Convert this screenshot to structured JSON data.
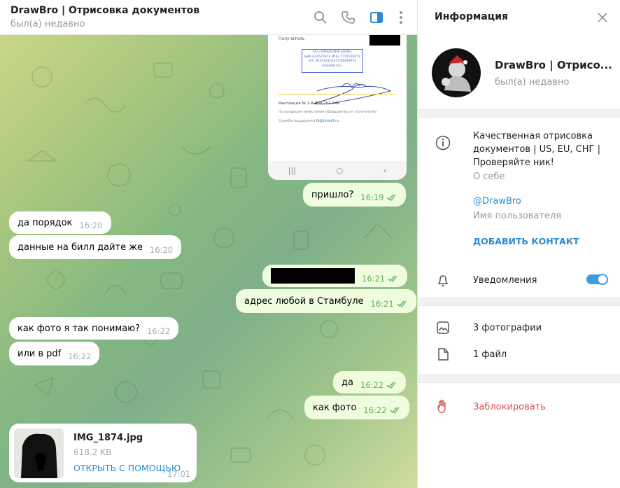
{
  "header": {
    "title": "DrawBro | Отрисовка документов",
    "status": "был(а) недавно"
  },
  "receipt": {
    "recipient_label": "Получатель",
    "stamp_line1": "АО «ТИНЬКОФФ БАНК»",
    "stamp_line2": "БИК 044525974 ИНН 7710140679",
    "stamp_line3": "К/С 30101810145250000974",
    "stamp_line4": "БАБАЕВ А.Е.",
    "receipt_no": "Квитанция  № 1-8-800-251-949",
    "help_line": "По вопросам зачисления обращайтесь к получателю",
    "support_label": "Служба поддержки",
    "support_email": "fb@tinkoff.ru"
  },
  "messages": [
    {
      "text": "пришло?",
      "time": "16:19",
      "dir": "out"
    },
    {
      "text": "да порядок",
      "time": "16:20",
      "dir": "in"
    },
    {
      "text": "данные на билл дайте же",
      "time": "16:20",
      "dir": "in"
    },
    {
      "text": "",
      "time": "16:21",
      "dir": "out"
    },
    {
      "text": "адрес любой в Стамбуле",
      "time": "16:21",
      "dir": "out"
    },
    {
      "text": "как фото я так понимаю?",
      "time": "16:22",
      "dir": "in"
    },
    {
      "text": "или в pdf",
      "time": "16:22",
      "dir": "in"
    },
    {
      "text": "да",
      "time": "16:22",
      "dir": "out"
    },
    {
      "text": "как фото",
      "time": "16:22",
      "dir": "out"
    }
  ],
  "file": {
    "name": "IMG_1874.jpg",
    "size": "618.2 KB",
    "action": "ОТКРЫТЬ С ПОМОЩЬЮ",
    "time": "17:01"
  },
  "info": {
    "title": "Информация",
    "name": "DrawBro | Отрисо...",
    "status": "был(а) недавно",
    "about": [
      "Качественная отрисовка",
      "документов | US, EU, СНГ |",
      "Проверяйте ник!"
    ],
    "about_label": "О себе",
    "username": "@DrawBro",
    "username_label": "Имя пользователя",
    "add_contact": "ДОБАВИТЬ КОНТАКТ",
    "notifications": "Уведомления",
    "notifications_on": true,
    "photos": "3 фотографии",
    "files": "1 файл",
    "block": "Заблокировать"
  },
  "colors": {
    "accent": "#2a8bd2",
    "danger": "#d9534f",
    "outgoing_bubble": "#effdde",
    "time_out": "#5fae5c"
  }
}
